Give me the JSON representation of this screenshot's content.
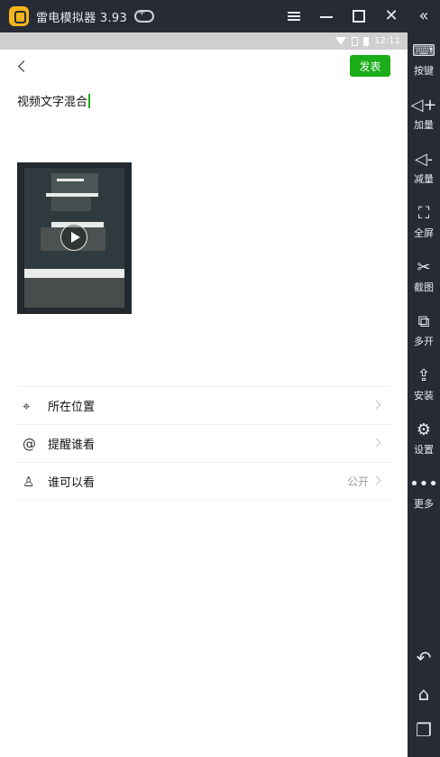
{
  "window": {
    "app_title": "雷电模拟器 3.93",
    "icons": [
      "app-logo-icon",
      "gamepad-icon",
      "menu-icon",
      "minimize-icon",
      "maximize-icon",
      "close-icon"
    ]
  },
  "sidebar": {
    "items": [
      {
        "label": "按键",
        "icon": "keyboard-icon"
      },
      {
        "label": "加量",
        "icon": "volume-up-icon"
      },
      {
        "label": "减量",
        "icon": "volume-down-icon"
      },
      {
        "label": "全屏",
        "icon": "fullscreen-icon"
      },
      {
        "label": "截图",
        "icon": "scissors-icon"
      },
      {
        "label": "多开",
        "icon": "multi-open-icon"
      },
      {
        "label": "安装",
        "icon": "apk-install-icon"
      },
      {
        "label": "设置",
        "icon": "gear-icon"
      },
      {
        "label": "更多",
        "icon": "more-dots-icon"
      }
    ]
  },
  "status_bar": {
    "time": "12:11"
  },
  "composer": {
    "publish_label": "发表",
    "post_text": "视频文字混合"
  },
  "options": [
    {
      "label": "所在位置",
      "value": "",
      "icon": "location-pin-icon"
    },
    {
      "label": "提醒谁看",
      "value": "",
      "icon": "at-icon"
    },
    {
      "label": "谁可以看",
      "value": "公开",
      "icon": "person-icon"
    }
  ],
  "colors": {
    "accent_green": "#1aad19",
    "emulator_bg": "#272b36"
  }
}
